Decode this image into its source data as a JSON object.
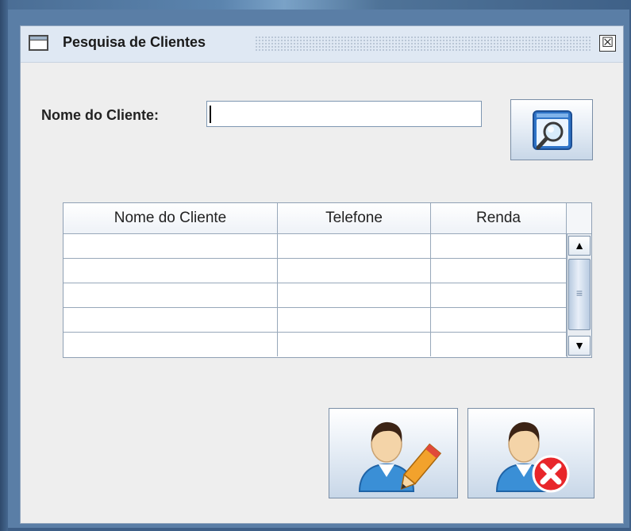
{
  "window": {
    "title": "Pesquisa de Clientes",
    "close_symbol": "☒"
  },
  "form": {
    "nome_label": "Nome do Cliente:",
    "nome_value": "",
    "search_button_icon": "search-window-icon"
  },
  "table": {
    "columns": [
      "Nome do Cliente",
      "Telefone",
      "Renda"
    ],
    "rows": [
      [
        "",
        "",
        ""
      ],
      [
        "",
        "",
        ""
      ],
      [
        "",
        "",
        ""
      ],
      [
        "",
        "",
        ""
      ],
      [
        "",
        "",
        ""
      ]
    ],
    "scroll_up_symbol": "▲",
    "scroll_down_symbol": "▼",
    "scroll_thumb_grip": "≡"
  },
  "actions": {
    "edit_icon": "user-edit-icon",
    "delete_icon": "user-delete-icon"
  },
  "colors": {
    "window_bg": "#eeeeee",
    "titlebar_bg": "#dfe8f3",
    "desktop_bg": "#3e5e86",
    "delete_red": "#e8262a",
    "pencil_orange": "#f2a22c"
  }
}
